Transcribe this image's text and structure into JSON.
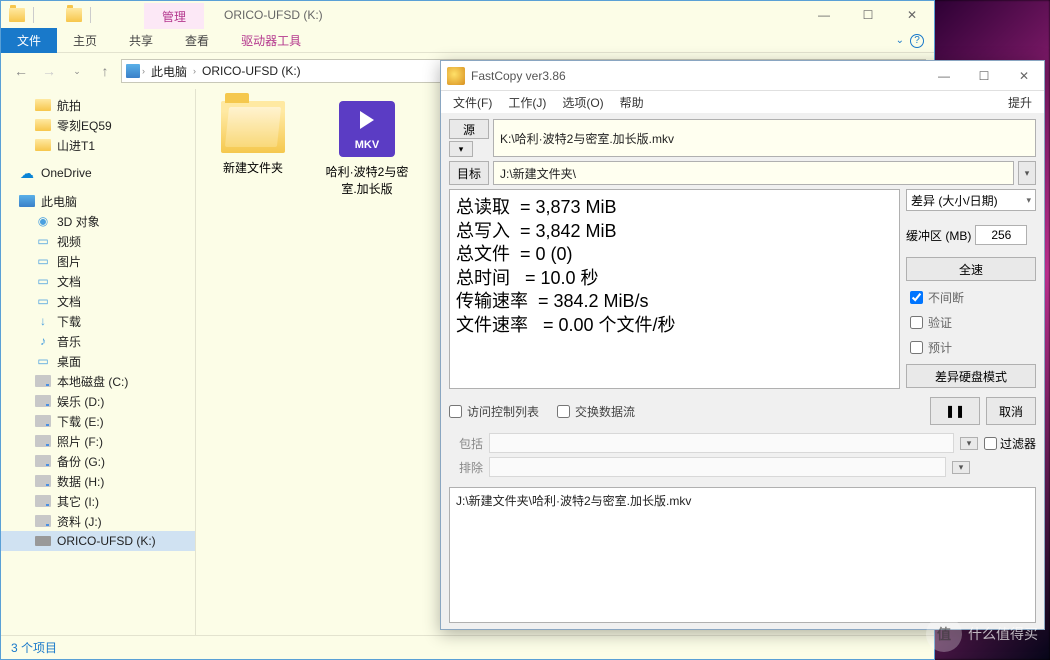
{
  "explorer": {
    "manage_tab": "管理",
    "drivetools": "驱动器工具",
    "window_title": "ORICO-UFSD (K:)",
    "ribbon": {
      "file": "文件",
      "home": "主页",
      "share": "共享",
      "view": "查看"
    },
    "address": {
      "thispc": "此电脑",
      "drive": "ORICO-UFSD (K:)"
    },
    "quick": {
      "a": "航拍",
      "b": "零刻EQ59",
      "c": "山进T1"
    },
    "onedrive": "OneDrive",
    "thispc": "此电脑",
    "pc": {
      "obj3d": "3D 对象",
      "video": "视频",
      "pic": "图片",
      "doc": "文档",
      "dl": "下载",
      "music": "音乐",
      "desk": "桌面",
      "c": "本地磁盘 (C:)",
      "d": "娱乐 (D:)",
      "e": "下载 (E:)",
      "f": "照片 (F:)",
      "g": "备份 (G:)",
      "h": "数据 (H:)",
      "i": "其它 (I:)",
      "j": "资料 (J:)",
      "k": "ORICO-UFSD (K:)"
    },
    "files": {
      "folder": "新建文件夹",
      "mkv": "哈利·波特2与密室.加长版",
      "mkv_tag": "MKV"
    },
    "status": "3 个项目"
  },
  "fastcopy": {
    "title": "FastCopy ver3.86",
    "menu": {
      "file": "文件(F)",
      "job": "工作(J)",
      "opt": "选项(O)",
      "help": "帮助",
      "boost": "提升"
    },
    "src_btn": "源",
    "dst_btn": "目标",
    "src": "K:\\哈利·波特2与密室.加长版.mkv",
    "dst": "J:\\新建文件夹\\",
    "stat_read": "总读取  = 3,873 MiB",
    "stat_write": "总写入  = 3,842 MiB",
    "stat_files": "总文件  = 0 (0)",
    "stat_time": "总时间   = 10.0 秒",
    "stat_rate": "传输速率  = 384.2 MiB/s",
    "stat_frate": "文件速率   = 0.00 个文件/秒",
    "mode": "差异 (大小/日期)",
    "buffer_label": "缓冲区 (MB)",
    "buffer_val": "256",
    "fullspeed": "全速",
    "nonstop": "不间断",
    "verify": "验证",
    "estimate": "预计",
    "diffdisk": "差异硬盘模式",
    "acl": "访问控制列表",
    "swap": "交换数据流",
    "pause": "❚❚",
    "cancel": "取消",
    "include": "包括",
    "exclude": "排除",
    "filter": "过滤器",
    "log": "J:\\新建文件夹\\哈利·波特2与密室.加长版.mkv"
  },
  "watermark": {
    "logo": "值",
    "text": "什么值得买"
  }
}
